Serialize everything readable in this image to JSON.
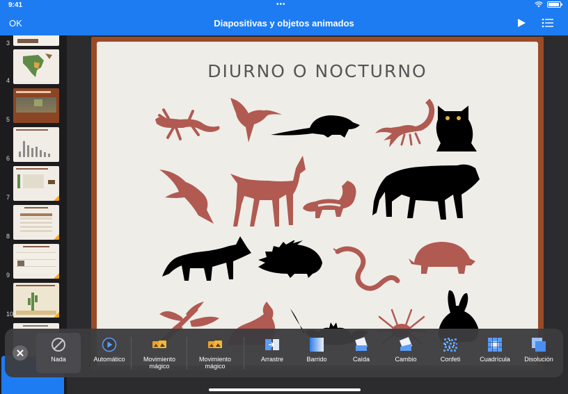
{
  "status": {
    "time": "9:41"
  },
  "nav": {
    "ok_label": "OK",
    "title": "Diapositivas y objetos animados"
  },
  "sidebar": {
    "slides": [
      {
        "num": "3"
      },
      {
        "num": "4"
      },
      {
        "num": "5"
      },
      {
        "num": "6"
      },
      {
        "num": "7"
      },
      {
        "num": "8"
      },
      {
        "num": "9"
      },
      {
        "num": "10"
      },
      {
        "num": ""
      }
    ]
  },
  "slide": {
    "title": "DIURNO O NOCTURNO"
  },
  "tray": {
    "items": [
      {
        "label": "Nada",
        "icon": "none-icon"
      },
      {
        "label": "Automático",
        "icon": "play-circle-icon"
      },
      {
        "label": "Movimiento mágico",
        "icon": "magic-move-icon"
      },
      {
        "label": "Movimiento mágico",
        "icon": "magic-move-icon"
      },
      {
        "label": "Arrastre",
        "icon": "push-icon"
      },
      {
        "label": "Barrido",
        "icon": "wipe-icon"
      },
      {
        "label": "Caída",
        "icon": "drop-icon"
      },
      {
        "label": "Cambio",
        "icon": "flip-icon"
      },
      {
        "label": "Confeti",
        "icon": "confetti-icon"
      },
      {
        "label": "Cuadrícula",
        "icon": "grid-icon"
      },
      {
        "label": "Disolución",
        "icon": "dissolve-icon"
      }
    ]
  },
  "colors": {
    "accent": "#1e7cf2",
    "slide_frame": "#9b4a28",
    "diurnal": "#b05a52",
    "nocturnal": "#000000"
  }
}
